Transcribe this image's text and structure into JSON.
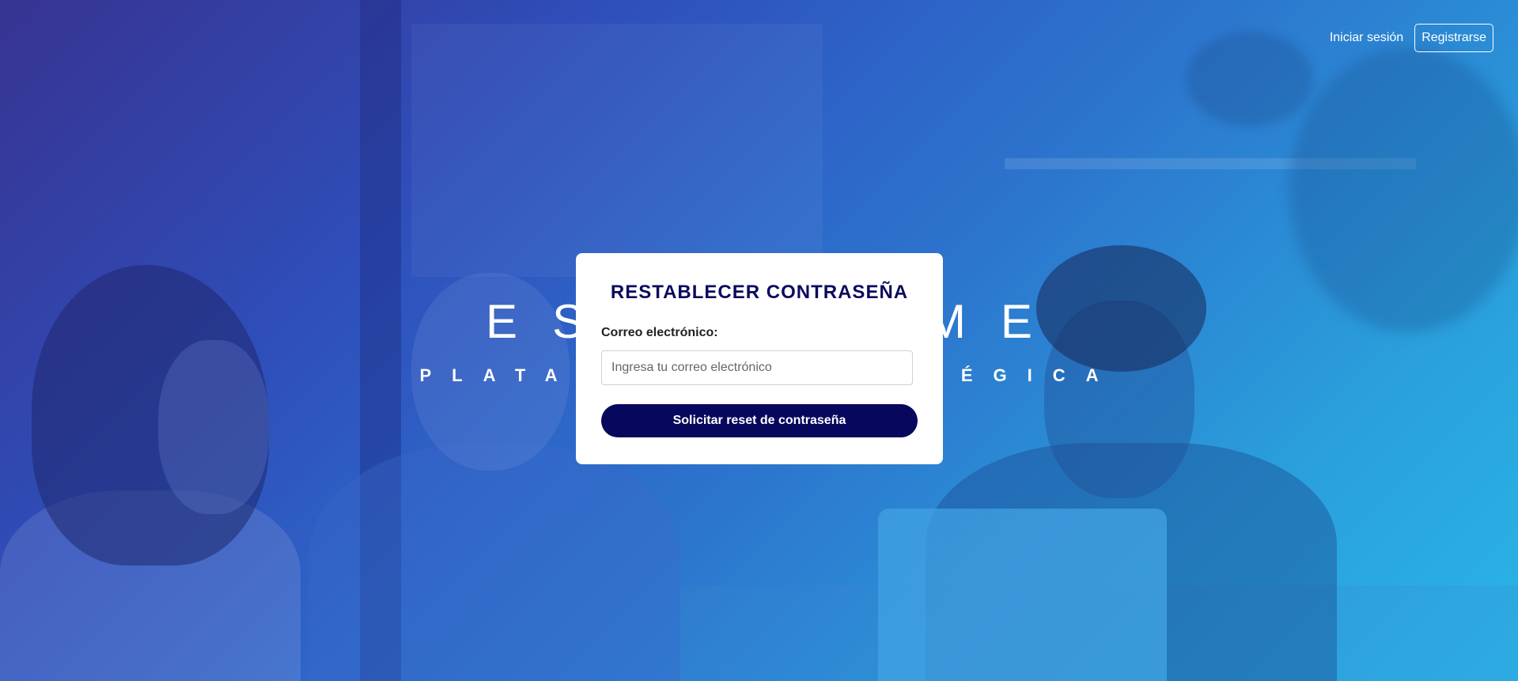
{
  "nav": {
    "login_label": "Iniciar sesión",
    "register_label": "Registrarse"
  },
  "hero": {
    "headline": "ESTRATIME",
    "subline": "PLATAFORMA ESTRATÉGICA"
  },
  "reset_form": {
    "title": "RESTABLECER CONTRASEÑA",
    "email_label": "Correo electrónico:",
    "email_placeholder": "Ingresa tu correo electrónico",
    "email_value": "",
    "submit_label": "Solicitar reset de contraseña"
  },
  "colors": {
    "primary_navy": "#07075e",
    "card_background": "#ffffff"
  }
}
